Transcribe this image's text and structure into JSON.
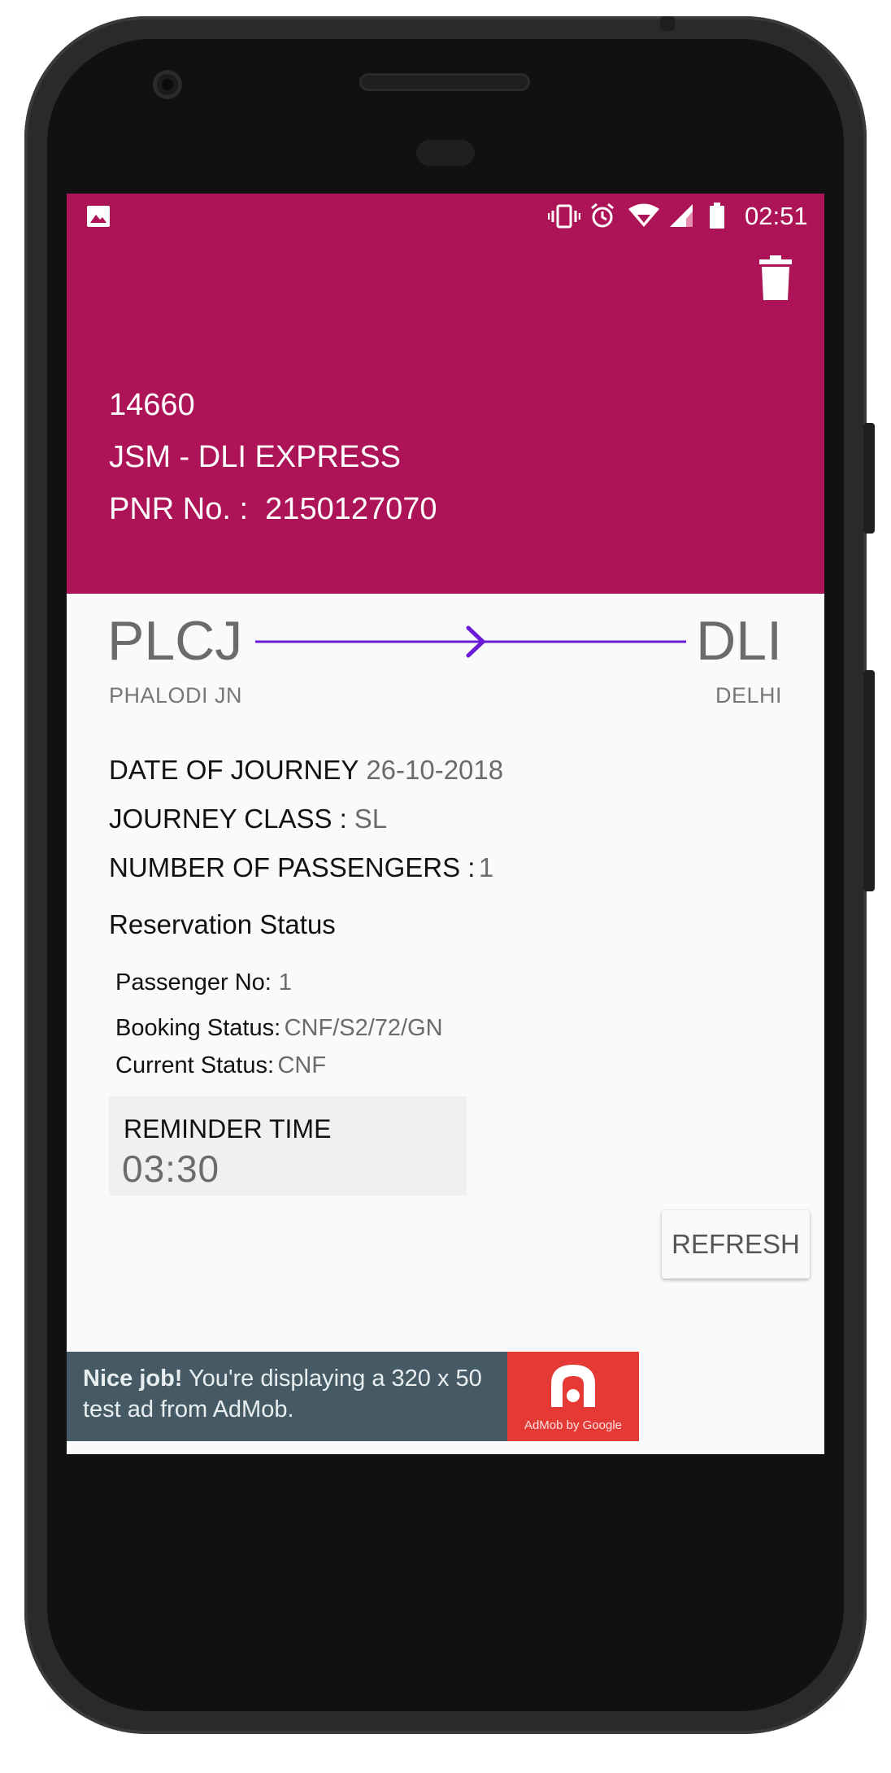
{
  "status_bar": {
    "time": "02:51",
    "left_icon": "image-icon",
    "right_icons": [
      "vibrate-icon",
      "alarm-icon",
      "wifi-icon",
      "signal-icon",
      "battery-icon"
    ]
  },
  "toolbar": {
    "delete_icon": "trash-icon"
  },
  "train": {
    "number": "14660",
    "name": "JSM - DLI EXPRESS",
    "pnr_label": "PNR No. :",
    "pnr_value": "2150127070"
  },
  "route": {
    "from_code": "PLCJ",
    "from_name": "PHALODI JN",
    "to_code": "DLI",
    "to_name": "DELHI",
    "arrow_color": "#6a1bd6"
  },
  "journey": {
    "date_label": "DATE OF JOURNEY",
    "date_value": "26-10-2018",
    "class_label": "JOURNEY CLASS :",
    "class_value": "SL",
    "passengers_label": "NUMBER OF PASSENGERS :",
    "passengers_value": "1"
  },
  "reservation": {
    "title": "Reservation Status",
    "passenger_no_label": "Passenger No:",
    "passenger_no_value": "1",
    "booking_status_label": "Booking Status:",
    "booking_status_value": "CNF/S2/72/GN",
    "current_status_label": "Current Status:",
    "current_status_value": "CNF"
  },
  "reminder": {
    "label": "REMINDER TIME",
    "time": "03:30"
  },
  "actions": {
    "refresh_label": "REFRESH"
  },
  "ad": {
    "bold": "Nice job!",
    "text": " You're displaying a 320 x 50 test ad from AdMob.",
    "logo_caption": "AdMob by Google"
  },
  "colors": {
    "header": "#ad1457",
    "screen_bg": "#fafafa",
    "ad_bg": "#455a64",
    "ad_logo_bg": "#e53935"
  },
  "nav": {
    "icons": [
      "back-icon",
      "home-icon",
      "recents-icon"
    ]
  }
}
